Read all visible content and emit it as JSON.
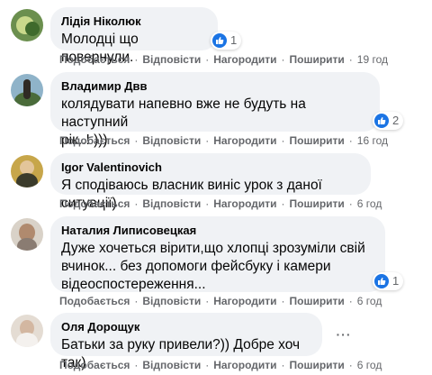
{
  "comments": [
    {
      "author": "Лідія Ніколюк",
      "lines": [
        "Молодці що повернули."
      ],
      "reactions": "1",
      "actions": {
        "like": "Подобається",
        "reply": "Відповісти",
        "award": "Нагородити",
        "share": "Поширити"
      },
      "time": "19 год"
    },
    {
      "author": "Владимир Двв",
      "lines": [
        "колядувати напевно вже не будуть на наступний",
        "рік..! )))"
      ],
      "reactions": "2",
      "actions": {
        "like": "Подобається",
        "reply": "Відповісти",
        "award": "Нагородити",
        "share": "Поширити"
      },
      "time": "16 год"
    },
    {
      "author": "Igor Valentinovich",
      "lines": [
        "Я сподіваюсь власник виніс урок з даної ситуації)"
      ],
      "reactions": "",
      "actions": {
        "like": "Подобається",
        "reply": "Відповісти",
        "award": "Нагородити",
        "share": "Поширити"
      },
      "time": "6 год"
    },
    {
      "author": "Наталия Липисовецкая",
      "lines": [
        "Дуже хочеться вірити,що хлопці зрозуміли свій",
        "вчинок... без допомоги фейсбуку і камери",
        "відеоспостереження..."
      ],
      "reactions": "1",
      "actions": {
        "like": "Подобається",
        "reply": "Відповісти",
        "award": "Нагородити",
        "share": "Поширити"
      },
      "time": "6 год"
    },
    {
      "author": "Оля Дорощук",
      "lines": [
        "Батьки за руку привели?)) Добре хоч так)"
      ],
      "reactions": "",
      "actions": {
        "like": "Подобається",
        "reply": "Відповісти",
        "award": "Нагородити",
        "share": "Поширити"
      },
      "time": "6 год"
    }
  ],
  "colors": {
    "bubble": "#f0f2f5",
    "like_blue": "#1b74e4",
    "meta_gray": "#65676b"
  },
  "icons": {
    "like": "thumbs-up-icon",
    "more": "more-dots-icon"
  },
  "more_label": "···"
}
